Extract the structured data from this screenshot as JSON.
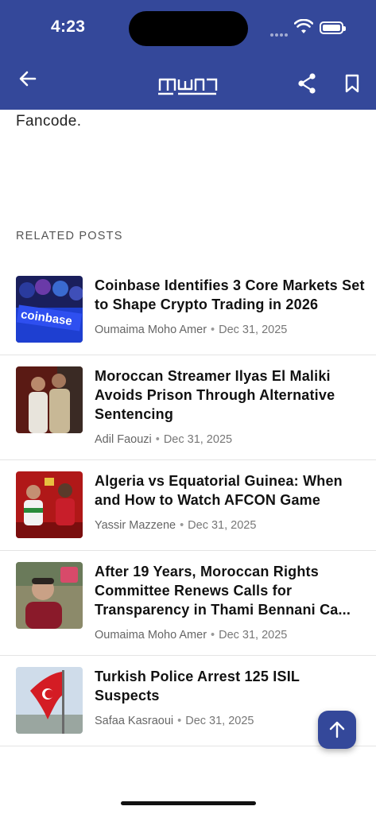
{
  "status_bar": {
    "time": "4:23"
  },
  "header": {
    "logo_text": "mwn",
    "back_icon": "arrow-left-icon",
    "share_icon": "share-icon",
    "bookmark_icon": "bookmark-icon",
    "color": "#34489a"
  },
  "article": {
    "tail_text": "Fancode."
  },
  "related": {
    "heading": "RELATED POSTS",
    "posts": [
      {
        "title": "Coinbase Identifies 3 Core Markets Set to Shape Crypto Trading in 2026",
        "author": "Oumaima Moho Amer",
        "date": "Dec 31, 2025"
      },
      {
        "title": "Moroccan Streamer Ilyas El Maliki Avoids Prison Through Alternative Sentencing",
        "author": "Adil Faouzi",
        "date": "Dec 31, 2025"
      },
      {
        "title": "Algeria vs Equatorial Guinea: When and How to Watch AFCON Game",
        "author": "Yassir Mazzene",
        "date": "Dec 31, 2025"
      },
      {
        "title": "After 19 Years, Moroccan Rights Committee Renews Calls for Transparency in Thami Bennani Ca...",
        "author": "Oumaima Moho Amer",
        "date": "Dec 31, 2025"
      },
      {
        "title": "Turkish Police Arrest 125 ISIL Suspects",
        "author": "Safaa Kasraoui",
        "date": "Dec 31, 2025"
      }
    ]
  },
  "scroll_top_icon": "arrow-up-icon",
  "separator": "•"
}
